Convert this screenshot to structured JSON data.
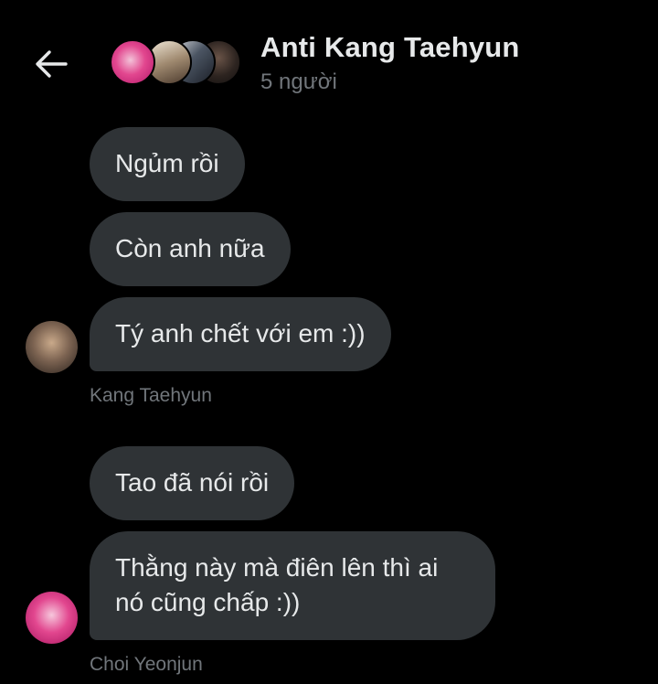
{
  "header": {
    "title": "Anti Kang Taehyun",
    "subtitle": "5 người",
    "back_icon": "arrow-left-icon"
  },
  "messages": [
    {
      "text": "Ngủm rồi"
    },
    {
      "text": "Còn anh nữa"
    },
    {
      "text": "Tý anh chết với em :))"
    },
    {
      "text": "Tao đã nói rồi"
    },
    {
      "text": "Thằng này mà điên lên thì ai nó cũng chấp :))"
    }
  ],
  "groups": [
    {
      "sender": "Kang Taehyun"
    },
    {
      "sender": "Choi Yeonjun"
    }
  ],
  "colors": {
    "background": "#000000",
    "bubble": "#2f3336",
    "text": "#e7e9ea",
    "muted": "#71767b"
  }
}
